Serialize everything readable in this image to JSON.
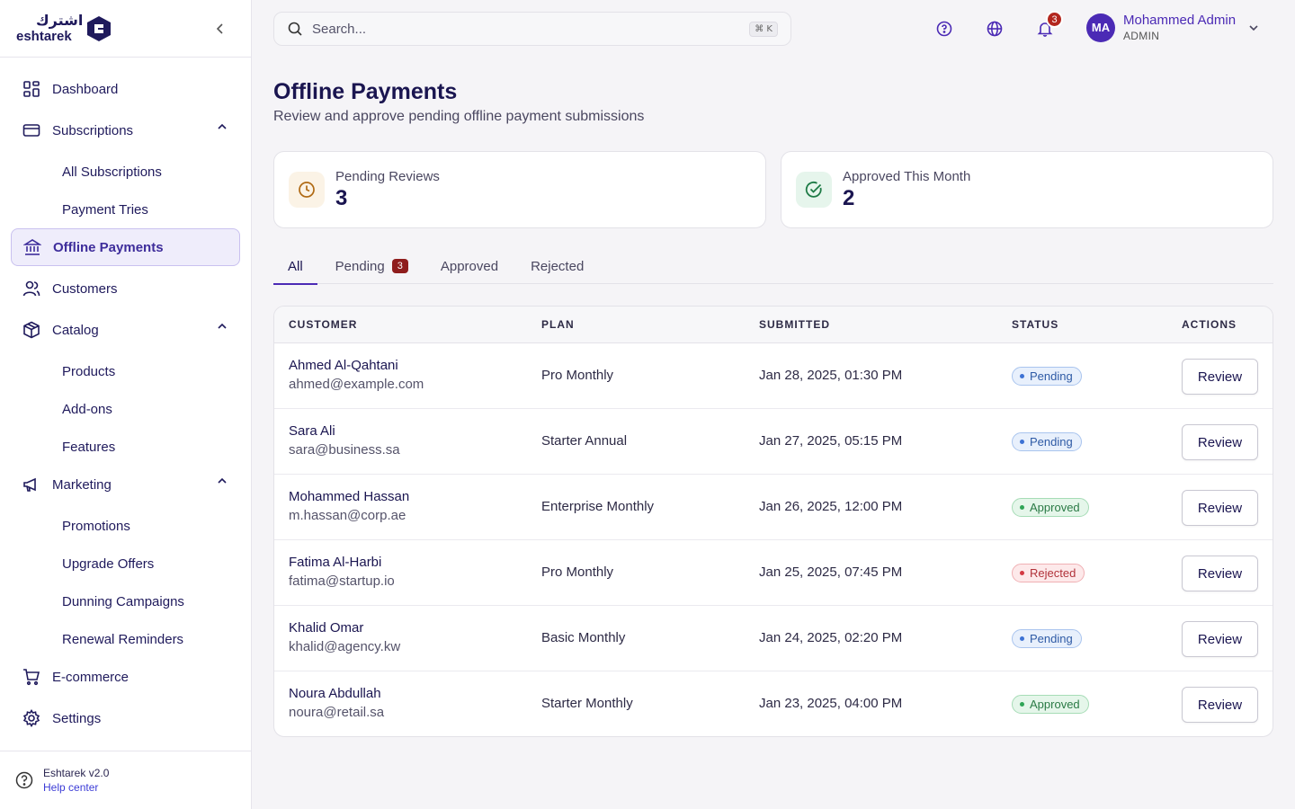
{
  "brand": {
    "arabic": "اشترك",
    "name": "eshtarek"
  },
  "sidebar": {
    "items": [
      {
        "label": "Dashboard"
      },
      {
        "label": "Subscriptions",
        "children": [
          "All Subscriptions",
          "Payment Tries"
        ]
      },
      {
        "label": "Offline Payments"
      },
      {
        "label": "Customers"
      },
      {
        "label": "Catalog",
        "children": [
          "Products",
          "Add-ons",
          "Features"
        ]
      },
      {
        "label": "Marketing",
        "children": [
          "Promotions",
          "Upgrade Offers",
          "Dunning Campaigns",
          "Renewal Reminders"
        ]
      },
      {
        "label": "E-commerce"
      },
      {
        "label": "Settings"
      }
    ],
    "footer": {
      "version": "Eshtarek v2.0",
      "help": "Help center"
    }
  },
  "topbar": {
    "search_placeholder": "Search...",
    "shortcut": "⌘ K",
    "notifications_count": "3",
    "user": {
      "initials": "MA",
      "name": "Mohammed Admin",
      "role": "ADMIN"
    }
  },
  "page": {
    "title": "Offline Payments",
    "subtitle": "Review and approve pending offline payment submissions"
  },
  "stats": [
    {
      "label": "Pending Reviews",
      "value": "3"
    },
    {
      "label": "Approved This Month",
      "value": "2"
    }
  ],
  "tabs": [
    {
      "label": "All"
    },
    {
      "label": "Pending",
      "count": "3"
    },
    {
      "label": "Approved"
    },
    {
      "label": "Rejected"
    }
  ],
  "table": {
    "headers": [
      "CUSTOMER",
      "PLAN",
      "SUBMITTED",
      "STATUS",
      "ACTIONS"
    ],
    "action_label": "Review",
    "rows": [
      {
        "name": "Ahmed Al-Qahtani",
        "email": "ahmed@example.com",
        "plan": "Pro Monthly",
        "submitted": "Jan 28, 2025, 01:30 PM",
        "status": "Pending"
      },
      {
        "name": "Sara Ali",
        "email": "sara@business.sa",
        "plan": "Starter Annual",
        "submitted": "Jan 27, 2025, 05:15 PM",
        "status": "Pending"
      },
      {
        "name": "Mohammed Hassan",
        "email": "m.hassan@corp.ae",
        "plan": "Enterprise Monthly",
        "submitted": "Jan 26, 2025, 12:00 PM",
        "status": "Approved"
      },
      {
        "name": "Fatima Al-Harbi",
        "email": "fatima@startup.io",
        "plan": "Pro Monthly",
        "submitted": "Jan 25, 2025, 07:45 PM",
        "status": "Rejected"
      },
      {
        "name": "Khalid Omar",
        "email": "khalid@agency.kw",
        "plan": "Basic Monthly",
        "submitted": "Jan 24, 2025, 02:20 PM",
        "status": "Pending"
      },
      {
        "name": "Noura Abdullah",
        "email": "noura@retail.sa",
        "plan": "Starter Monthly",
        "submitted": "Jan 23, 2025, 04:00 PM",
        "status": "Approved"
      }
    ]
  }
}
